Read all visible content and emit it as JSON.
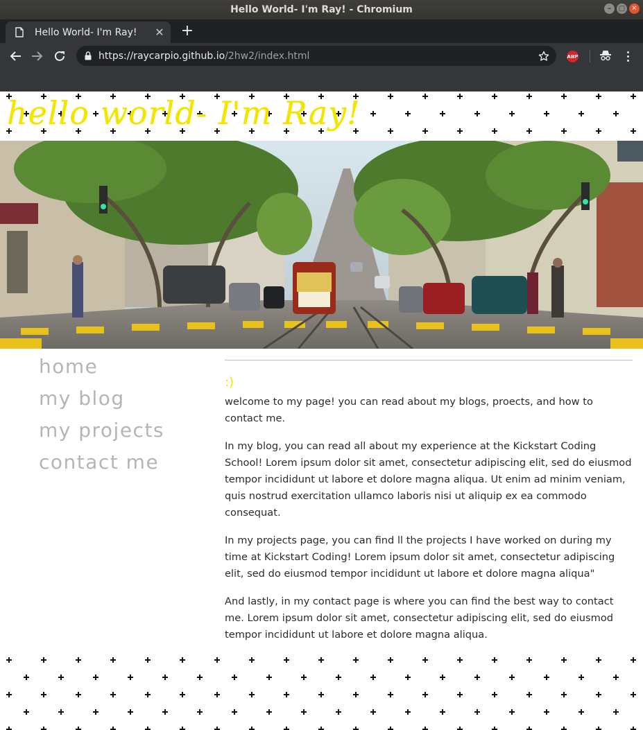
{
  "window": {
    "title": "Hello World- I'm Ray! - Chromium"
  },
  "tab": {
    "title": "Hello World- I'm Ray!"
  },
  "address_bar": {
    "url_host": "https://raycarpio.github.io",
    "url_path": "/2hw2/index.html"
  },
  "extensions": {
    "abp_label": "ABP"
  },
  "page": {
    "site_title": "hello world- I'm Ray!",
    "nav": [
      {
        "label": "home"
      },
      {
        "label": "my blog"
      },
      {
        "label": "my projects"
      },
      {
        "label": "contact me"
      }
    ],
    "smiley": ":)",
    "paragraphs": [
      "welcome to my page! you can read about my blogs, proects, and how to contact me.",
      "In my blog, you can read all about my experience at the Kickstart Coding School! Lorem ipsum dolor sit amet, consectetur adipiscing elit, sed do eiusmod tempor incididunt ut labore et dolore magna aliqua. Ut enim ad minim veniam, quis nostrud exercitation ullamco laboris nisi ut aliquip ex ea commodo consequat.",
      "In my projects page, you can find ll the projects I have worked on during my time at Kickstart Coding! Lorem ipsum dolor sit amet, consectetur adipiscing elit, sed do eiusmod tempor incididunt ut labore et dolore magna aliqua\"",
      "And lastly, in my contact page is where you can find the best way to contact me. Lorem ipsum dolor sit amet, consectetur adipiscing elit, sed do eiusmod tempor incididunt ut labore et dolore magna aliqua."
    ]
  },
  "colors": {
    "accent_yellow": "#f2e600",
    "nav_gray": "#b5b5b5",
    "body_text": "#2c2c2c"
  },
  "icons": [
    "page-icon",
    "close-icon",
    "plus-icon",
    "back-icon",
    "forward-icon",
    "reload-icon",
    "lock-icon",
    "star-icon",
    "adblock-icon",
    "incognito-icon",
    "menu-icon"
  ]
}
